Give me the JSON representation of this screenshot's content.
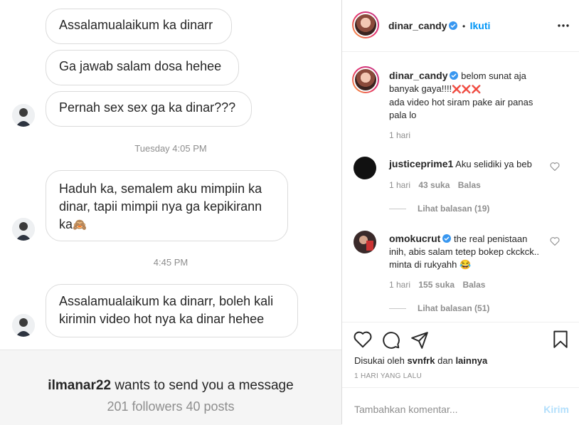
{
  "dm": {
    "messages": [
      "Assalamualaikum ka dinarr",
      "Ga jawab salam dosa hehee",
      "Pernah sex sex ga ka dinar???",
      "Haduh ka, semalem aku mimpiin ka dinar, tapii mimpii nya ga kepikirann ka",
      "Assalamualaikum ka dinarr, boleh kali kirimin video hot nya ka dinar hehee"
    ],
    "emoji_see_no_evil": "🙈",
    "timestamps": [
      "Tuesday 4:05 PM",
      "4:45 PM"
    ],
    "request": {
      "username": "ilmanar22",
      "line": "wants to send you a message",
      "stats": "201 followers 40 posts"
    }
  },
  "post": {
    "header": {
      "username": "dinar_candy",
      "separator": "•",
      "follow_label": "Ikuti",
      "more_icon": "more-horizontal-icon"
    },
    "caption": {
      "username": "dinar_candy",
      "text_1": "belom sunat aja banyak gaya!!!!",
      "cross_marks": "❌❌❌",
      "text_2": "ada video hot siram pake air panas pala lo",
      "time": "1 hari"
    },
    "comments": [
      {
        "username": "justiceprime1",
        "text": "Aku selidiki ya beb",
        "time": "1 hari",
        "likes": "43 suka",
        "reply": "Balas",
        "view_replies": "Lihat balasan (19)"
      },
      {
        "username": "omokucrut",
        "verified": true,
        "text": "the real penistaan inih, abis salam tetep bokep ckckck.. minta di rukyahh",
        "emoji": "😂",
        "time": "1 hari",
        "likes": "155 suka",
        "reply": "Balas",
        "view_replies": "Lihat balasan (51)"
      }
    ],
    "liked_by": {
      "prefix": "Disukai oleh",
      "user": "svnfrk",
      "mid": "dan",
      "others": "lainnya"
    },
    "date": "1 HARI YANG LALU",
    "add_comment": {
      "placeholder": "Tambahkan komentar...",
      "post_label": "Kirim"
    },
    "colors": {
      "accent": "#0095f6",
      "verified": "#3897f0",
      "muted": "#8e8e8e"
    }
  }
}
